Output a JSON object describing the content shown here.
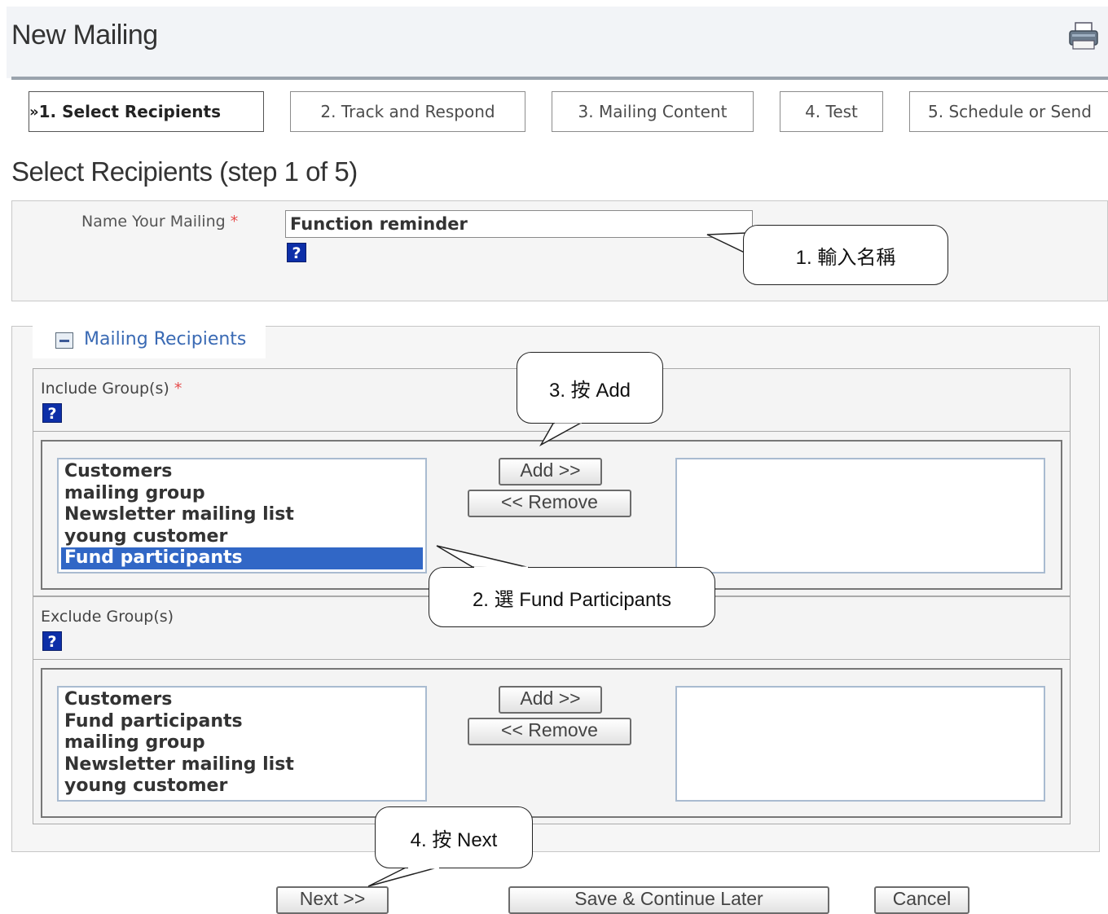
{
  "header": {
    "title": "New Mailing",
    "print_icon": "printer-icon"
  },
  "tabs": [
    {
      "label": "1. Select Recipients",
      "prefix": "»",
      "active": true
    },
    {
      "label": "2. Track and Respond"
    },
    {
      "label": "3. Mailing Content"
    },
    {
      "label": "4. Test"
    },
    {
      "label": "5. Schedule or Send"
    }
  ],
  "section_title": "Select Recipients (step 1 of 5)",
  "name_field": {
    "label": "Name Your Mailing",
    "required_mark": "*",
    "value": "Function reminder",
    "help": "?"
  },
  "recipients": {
    "legend": "Mailing Recipients",
    "include": {
      "label": "Include Group(s)",
      "required_mark": "*",
      "help": "?",
      "available": [
        "Customers",
        "mailing group",
        "Newsletter mailing list",
        "young customer",
        "Fund participants"
      ],
      "selected_index": 4,
      "add_label": "Add >>",
      "remove_label": "<< Remove"
    },
    "exclude": {
      "label": "Exclude Group(s)",
      "help": "?",
      "available": [
        "Customers",
        "Fund participants",
        "mailing group",
        "Newsletter mailing list",
        "young customer"
      ],
      "add_label": "Add >>",
      "remove_label": "<< Remove"
    }
  },
  "buttons": {
    "next": "Next >>",
    "save_later": "Save & Continue Later",
    "cancel": "Cancel"
  },
  "callouts": {
    "c1": "1. 輸入名稱",
    "c2": "2. 選 Fund Participants",
    "c3": "3. 按 Add",
    "c4": "4. 按 Next"
  },
  "colors": {
    "selected": "#3167c6",
    "help_badge": "#0d2fa8",
    "legend_text": "#3a6ab4",
    "required": "#e64c4c"
  }
}
